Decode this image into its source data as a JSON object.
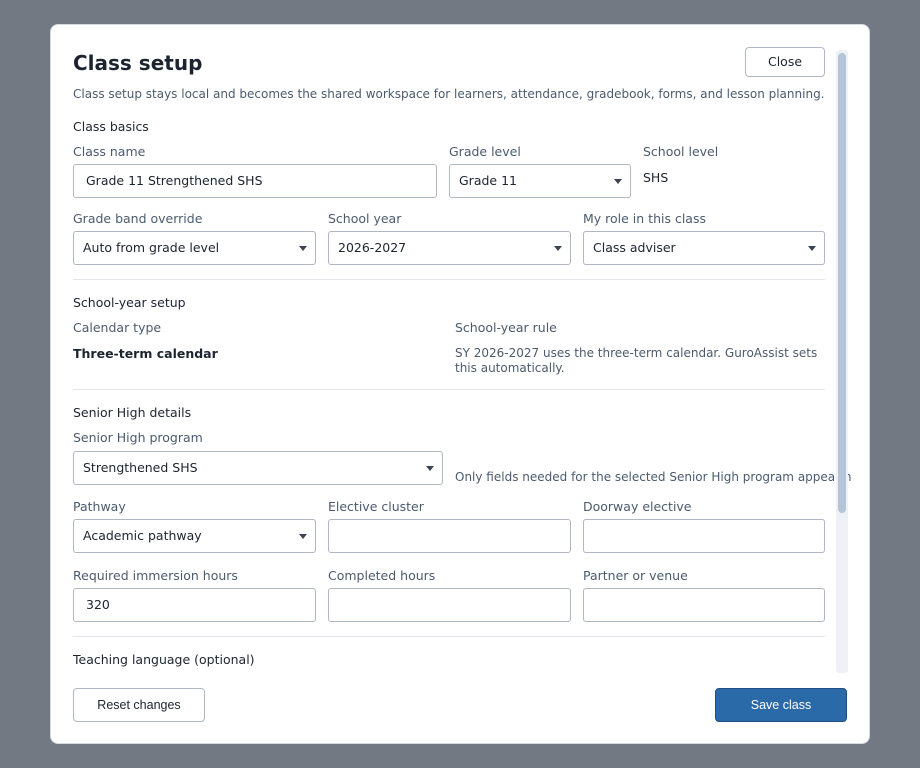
{
  "dialog": {
    "title": "Class setup",
    "subtitle": "Class setup stays local and becomes the shared workspace for learners, attendance, gradebook, forms, and lesson planning.",
    "close_label": "Close"
  },
  "class_basics": {
    "section_title": "Class basics",
    "class_name_label": "Class name",
    "class_name_value": "Grade 11 Strengthened SHS",
    "grade_level_label": "Grade level",
    "grade_level_value": "Grade 11",
    "school_level_label": "School level",
    "school_level_value": "SHS",
    "grade_band_label": "Grade band override",
    "grade_band_value": "Auto from grade level",
    "school_year_label": "School year",
    "school_year_value": "2026-2027",
    "role_label": "My role in this class",
    "role_value": "Class adviser"
  },
  "school_year_setup": {
    "section_title": "School-year setup",
    "calendar_type_label": "Calendar type",
    "calendar_type_value": "Three-term calendar",
    "rule_label": "School-year rule",
    "rule_text": "SY 2026-2027 uses the three-term calendar. GuroAssist sets this automatically."
  },
  "senior_high": {
    "section_title": "Senior High details",
    "program_label": "Senior High program",
    "program_value": "Strengthened SHS",
    "program_note": "Only fields needed for the selected Senior High program appear here.",
    "pathway_label": "Pathway",
    "pathway_value": "Academic pathway",
    "elective_cluster_label": "Elective cluster",
    "elective_cluster_value": "",
    "doorway_elective_label": "Doorway elective",
    "doorway_elective_value": "",
    "immersion_hours_label": "Required immersion hours",
    "immersion_hours_value": "320",
    "completed_hours_label": "Completed hours",
    "completed_hours_value": "",
    "partner_label": "Partner or venue",
    "partner_value": ""
  },
  "teaching_language": {
    "section_title": "Teaching language (optional)"
  },
  "footer": {
    "reset_label": "Reset changes",
    "save_label": "Save class"
  },
  "colors": {
    "overlay": "#737982",
    "primary": "#2b6aa8",
    "border": "#aeb8c5",
    "muted_text": "#4b5b6e"
  },
  "icons": {
    "select_caret": "chevron-down-icon"
  }
}
